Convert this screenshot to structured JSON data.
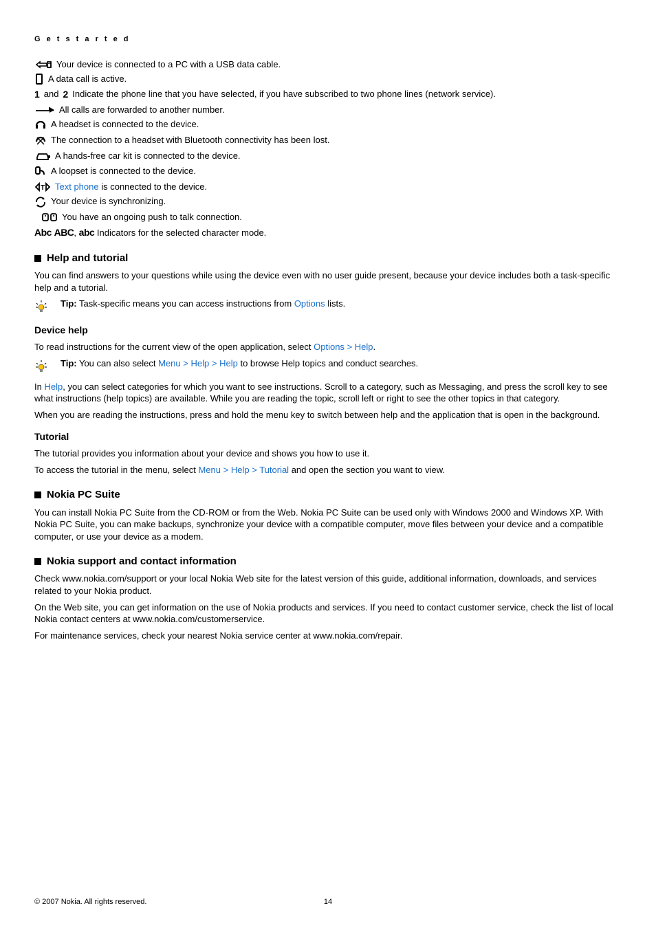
{
  "header": "G e t   s t a r t e d",
  "indicators": {
    "usb": "Your device is connected to a PC with a USB data cable.",
    "data_call": "A data call is active.",
    "phone_line_pre": " and ",
    "phone_line_post": " Indicate the phone line that you have selected, if you have subscribed to two phone lines (network service).",
    "forward": "All calls are forwarded to another number.",
    "headset": "A headset is connected to the device.",
    "bt_lost": "The connection to a headset with Bluetooth connectivity has been lost.",
    "car_kit": "A hands-free car kit is connected to the device.",
    "loopset": "A loopset is connected to the device.",
    "text_phone_link": "Text phone",
    "text_phone_post": " is connected to the device.",
    "sync": "Your device is synchronizing.",
    "ptt": "You have an ongoing push to talk connection.",
    "char_mode": " Indicators for the selected character mode."
  },
  "help_tutorial": {
    "title": "Help and tutorial",
    "intro": "You can find answers to your questions while using the device even with no user guide present, because your device includes both a task-specific help and a tutorial.",
    "tip_label": "Tip:",
    "tip1_a": " Task-specific means you can access instructions from ",
    "tip1_link": "Options",
    "tip1_c": " lists."
  },
  "device_help": {
    "title": "Device help",
    "line1_a": "To read instructions for the current view of the open application, select ",
    "line1_b": "Options",
    "line1_c": "Help",
    "tip2_a": " You can also select ",
    "tip2_m": "Menu",
    "tip2_h1": "Help",
    "tip2_h2": "Help",
    "tip2_d": " to browse Help topics and conduct searches.",
    "p2_a": "In ",
    "p2_link": "Help",
    "p2_b": ", you can select categories for which you want to see instructions. Scroll to a category, such as Messaging, and press the scroll key to see what instructions (help topics) are available. While you are reading the topic, scroll left or right to see the other topics in that category.",
    "p3": "When you are reading the instructions, press and hold the menu key to switch between help and the application that is open in the background."
  },
  "tutorial": {
    "title": "Tutorial",
    "p1": "The tutorial provides you information about your device and shows you how to use it.",
    "p2_a": "To access the tutorial in the menu, select ",
    "p2_m": "Menu",
    "p2_h": "Help",
    "p2_t": "Tutorial",
    "p2_b": " and open the section you want to view."
  },
  "pc_suite": {
    "title": "Nokia PC Suite",
    "p1": "You can install Nokia PC Suite from the CD-ROM or from the Web. Nokia PC Suite can be used only with Windows 2000 and Windows XP. With Nokia PC Suite, you can make backups, synchronize your device with a compatible computer, move files between your device and a compatible computer, or use your device as a modem."
  },
  "support": {
    "title": "Nokia support and contact information",
    "p1": "Check www.nokia.com/support or your local Nokia Web site for the latest version of this guide, additional information, downloads, and services related to your Nokia product.",
    "p2": "On the Web site, you can get information on the use of Nokia products and services. If you need to contact customer service, check the list of local Nokia contact centers at www.nokia.com/customerservice.",
    "p3": "For maintenance services, check your nearest Nokia service center at www.nokia.com/repair."
  },
  "footer": {
    "copyright": "© 2007 Nokia. All rights reserved.",
    "page": "14"
  },
  "glyphs": {
    "one": "1",
    "two": "2",
    "abc1": "Abc",
    "abc2": "ABC",
    "abc3": "abc",
    "gt": ">",
    "dot": "."
  }
}
